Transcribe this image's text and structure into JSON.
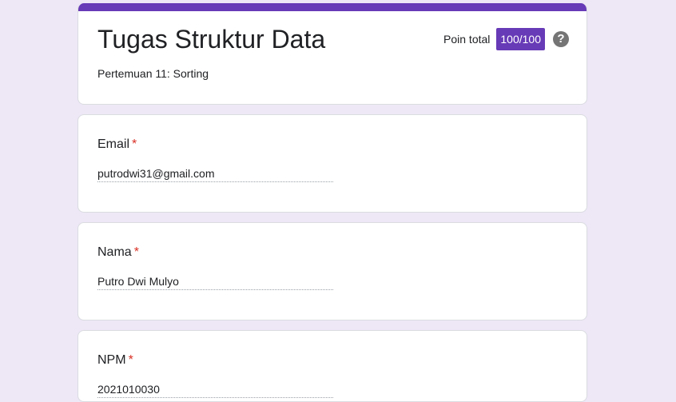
{
  "form": {
    "title": "Tugas Struktur Data",
    "description": "Pertemuan 11: Sorting",
    "points_label": "Poin total",
    "points_value": "100/100",
    "help_symbol": "?",
    "accent_color": "#673ab7",
    "background_color": "#ede7f6"
  },
  "questions": [
    {
      "label": "Email",
      "required_mark": "*",
      "answer": "putrodwi31@gmail.com"
    },
    {
      "label": "Nama",
      "required_mark": "*",
      "answer": "Putro Dwi Mulyo"
    },
    {
      "label": "NPM",
      "required_mark": "*",
      "answer": "2021010030"
    }
  ]
}
